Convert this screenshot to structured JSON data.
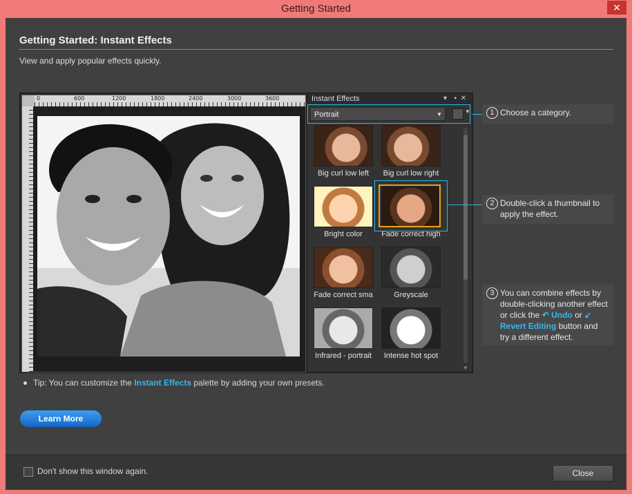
{
  "window": {
    "title": "Getting Started",
    "close_glyph": "✕"
  },
  "content": {
    "heading": "Getting Started: Instant Effects",
    "subtitle": "View and apply popular effects quickly."
  },
  "screenshot": {
    "ruler_numbers": [
      "0",
      "600",
      "1200",
      "1800",
      "2400",
      "3000",
      "3600"
    ],
    "panel": {
      "title": "Instant Effects",
      "category": "Portrait",
      "thumbnails": [
        {
          "label": "Big curl low left"
        },
        {
          "label": "Big curl low right"
        },
        {
          "label": "Bright color"
        },
        {
          "label": "Fade correct high"
        },
        {
          "label": "Fade correct sma"
        },
        {
          "label": "Greyscale"
        },
        {
          "label": "Infrared - portrait"
        },
        {
          "label": "Intense hot spot"
        }
      ]
    }
  },
  "callouts": {
    "c1": {
      "num": "1",
      "text": "Choose a category."
    },
    "c2": {
      "num": "2",
      "text": "Double-click a thumbnail to apply the effect."
    },
    "c3": {
      "num": "3",
      "text_a": "You can combine effects by double-clicking another effect or click the",
      "undo": "Undo",
      "or": "or",
      "revert": "Revert Editing",
      "text_b": "button and try a different effect."
    }
  },
  "tip": {
    "prefix": "Tip: You can customize the",
    "link": "Instant Effects",
    "suffix": "palette by adding your own presets."
  },
  "learn_more": "Learn More",
  "footer": {
    "dont_show": "Don't show this window again.",
    "close": "Close"
  },
  "colors": {
    "accent": "#2eb8e6",
    "link": "#35b8f0",
    "selection": "#e8a317",
    "titlebar": "#f07a78"
  }
}
